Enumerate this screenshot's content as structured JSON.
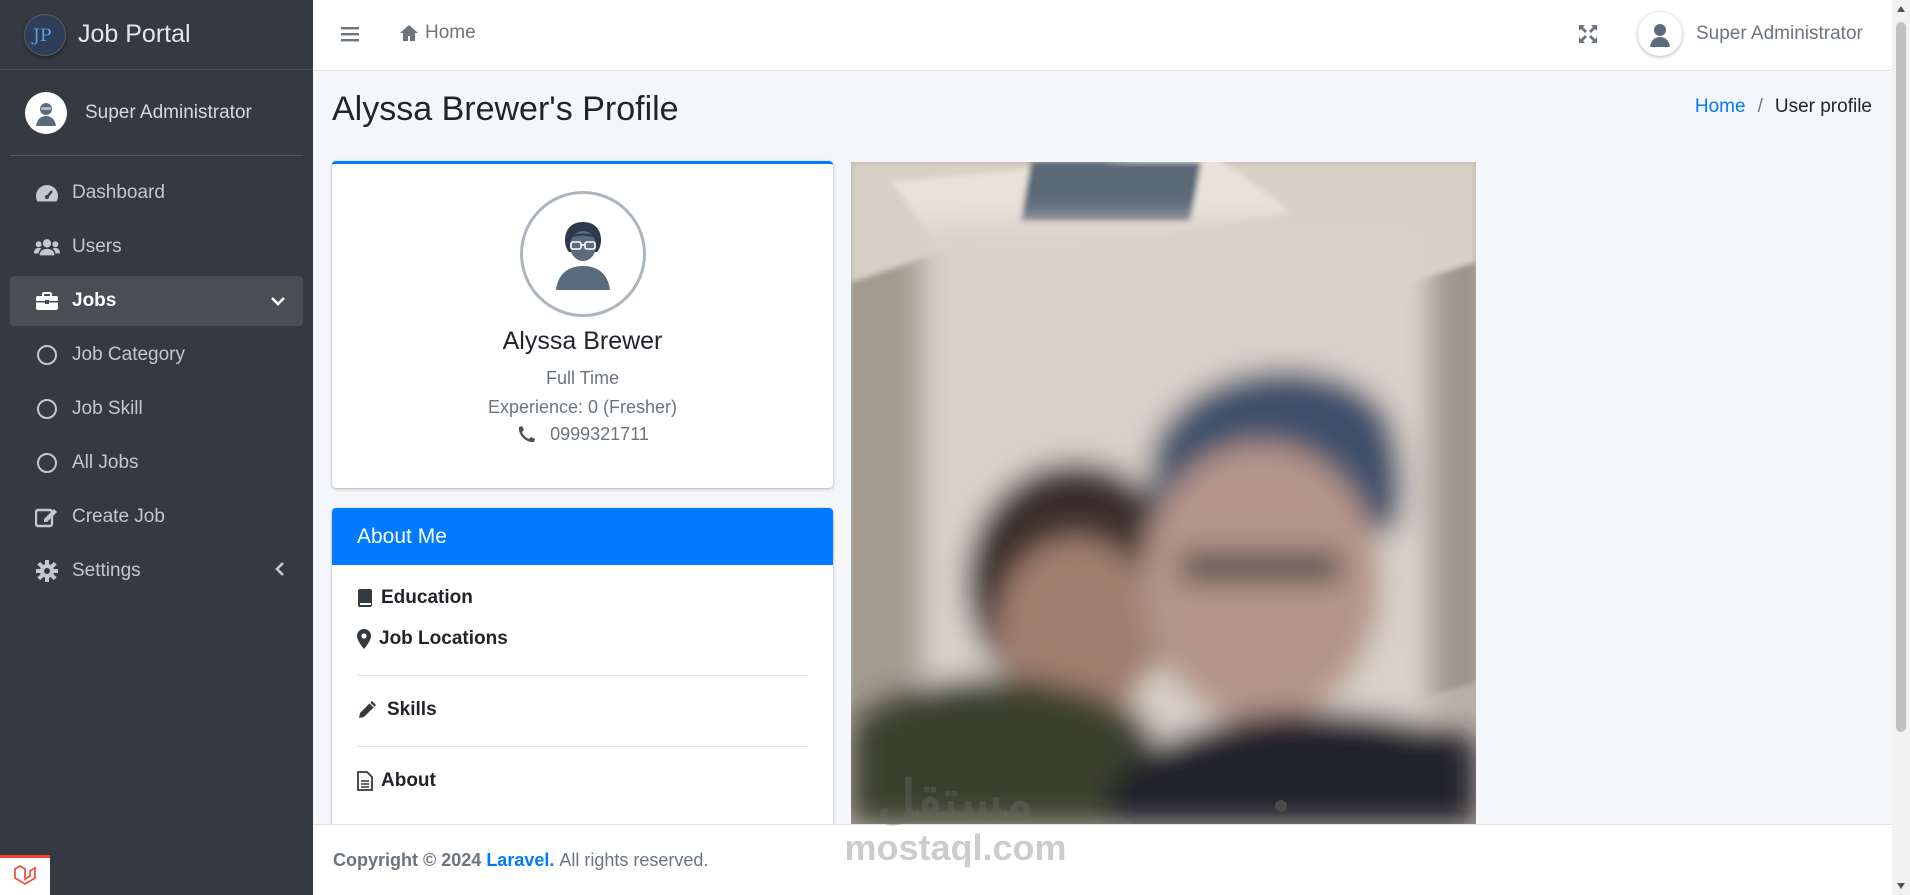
{
  "brand": {
    "name": "Job Portal",
    "logo_text": "JP"
  },
  "sidebar": {
    "user": "Super Administrator",
    "items": [
      {
        "label": "Dashboard",
        "icon": "tachometer-icon"
      },
      {
        "label": "Users",
        "icon": "users-icon"
      },
      {
        "label": "Jobs",
        "icon": "briefcase-icon",
        "active": true,
        "expanded": true
      },
      {
        "label": "Job Category",
        "icon": "circle-icon"
      },
      {
        "label": "Job Skill",
        "icon": "circle-icon"
      },
      {
        "label": "All Jobs",
        "icon": "circle-icon"
      },
      {
        "label": "Create Job",
        "icon": "edit-icon"
      },
      {
        "label": "Settings",
        "icon": "gear-icon"
      }
    ]
  },
  "topbar": {
    "home": "Home",
    "user": "Super Administrator"
  },
  "page": {
    "title": "Alyssa Brewer's Profile",
    "breadcrumb": {
      "home": "Home",
      "sep": "/",
      "current": "User profile"
    }
  },
  "profile": {
    "name": "Alyssa Brewer",
    "employment": "Full Time",
    "experience": "Experience: 0 (Fresher)",
    "phone": "0999321711"
  },
  "about": {
    "title": "About Me",
    "education": "Education",
    "locations": "Job Locations",
    "skills": "Skills",
    "about": "About"
  },
  "footer": {
    "copyright": "Copyright © 2024",
    "link": "Laravel.",
    "rights": "All rights reserved."
  },
  "watermark": {
    "arabic": "مستقل",
    "latin": "mostaql.com"
  },
  "colors": {
    "sidebar": "#343a40",
    "primary": "#007bff",
    "background": "#f4f6f9"
  }
}
